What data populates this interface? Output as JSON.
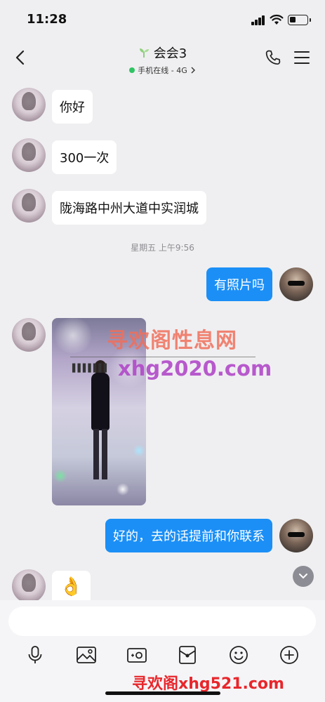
{
  "status_bar": {
    "time": "11:28",
    "battery_level": 0.35
  },
  "header": {
    "title": "会会3",
    "status": "手机在线 - 4G",
    "status_color": "#2fc463"
  },
  "messages": [
    {
      "side": "left",
      "text": "你好"
    },
    {
      "side": "left",
      "text": "300一次"
    },
    {
      "side": "left",
      "text": "陇海路中州大道中实润城"
    },
    {
      "side": "right",
      "text": "有照片吗"
    },
    {
      "side": "right",
      "text": "好的，去的话提前和你联系"
    }
  ],
  "timestamp": "星期五 上午9:56",
  "emoji": "👌",
  "watermarks": {
    "overlay_title": "寻欢阁性息网",
    "overlay_url": "xhg2020.com",
    "footer": "寻欢阁xhg521.com"
  },
  "input": {
    "placeholder": ""
  },
  "toolbar": [
    "mic-icon",
    "image-icon",
    "camera-icon",
    "red-packet-icon",
    "emoji-icon",
    "plus-icon"
  ],
  "colors": {
    "right_bubble": "#1b8ff6",
    "left_bubble": "#ffffff",
    "background": "#efeff1"
  }
}
